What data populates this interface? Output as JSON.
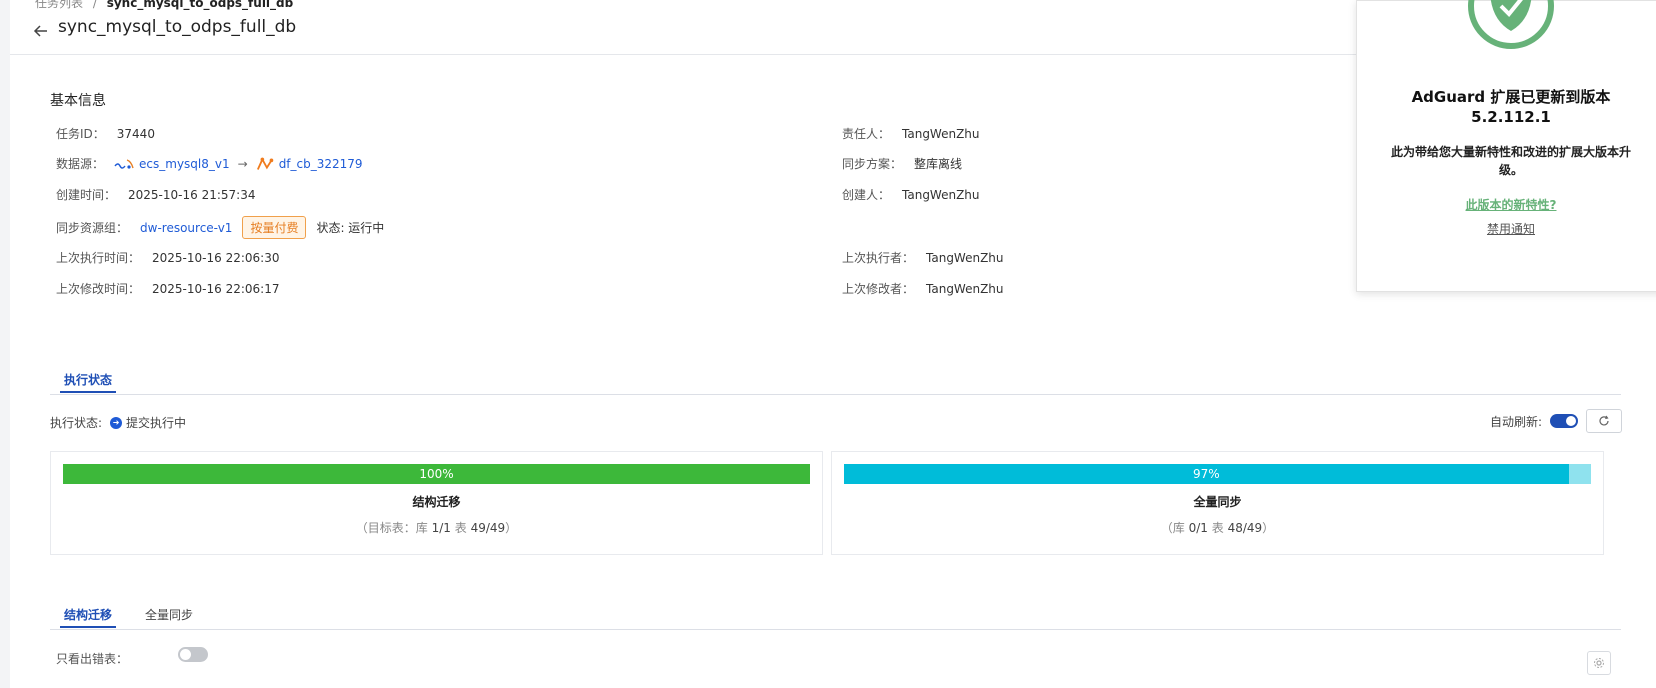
{
  "breadcrumb": {
    "parent": "任务列表",
    "separator": "/",
    "current": "sync_mysql_to_odps_full_db"
  },
  "header": {
    "title": "sync_mysql_to_odps_full_db"
  },
  "basic_info": {
    "section_title": "基本信息",
    "task_id": {
      "label": "任务ID：",
      "value": "37440"
    },
    "datasource": {
      "label": "数据源：",
      "source": "ecs_mysql8_v1",
      "arrow": "→",
      "target": "df_cb_322179"
    },
    "created_time": {
      "label": "创建时间：",
      "value": "2025-10-16 21:57:34"
    },
    "resource_group": {
      "label": "同步资源组：",
      "value": "dw-resource-v1",
      "billing_tag": "按量付费",
      "status": "状态: 运行中"
    },
    "last_exec_time": {
      "label": "上次执行时间：",
      "value": "2025-10-16 22:06:30"
    },
    "last_modified_time": {
      "label": "上次修改时间：",
      "value": "2025-10-16 22:06:17"
    },
    "owner": {
      "label": "责任人：",
      "value": "TangWenZhu"
    },
    "sync_plan": {
      "label": "同步方案：",
      "value": "整库离线"
    },
    "creator": {
      "label": "创建人：",
      "value": "TangWenZhu"
    },
    "last_executor": {
      "label": "上次执行者：",
      "value": "TangWenZhu"
    },
    "last_modifier": {
      "label": "上次修改者：",
      "value": "TangWenZhu"
    }
  },
  "exec_tabs": [
    {
      "label": "执行状态",
      "active": true
    }
  ],
  "exec_status": {
    "label": "执行状态:",
    "value": "提交执行中",
    "auto_refresh_label": "自动刷新:",
    "auto_refresh_on": true
  },
  "progress_cards": [
    {
      "percent_text": "100%",
      "progress": 1.0,
      "bar_color": "#3db83a",
      "title": "结构迁移",
      "sub_prefix": "（目标表：库 ",
      "sub_db": "1/1",
      "sub_mid": " 表 ",
      "sub_tbl": "49/49",
      "sub_suffix": "）"
    },
    {
      "percent_text": "97%",
      "progress": 0.97,
      "bar_color": "#00bcd9",
      "title": "全量同步",
      "sub_prefix": "（库 ",
      "sub_db": "0/1",
      "sub_mid": " 表 ",
      "sub_tbl": "48/49",
      "sub_suffix": "）"
    }
  ],
  "detail_tabs": [
    {
      "label": "结构迁移",
      "active": true
    },
    {
      "label": "全量同步",
      "active": false
    }
  ],
  "filter": {
    "label": "只看出错表：",
    "enabled": false
  },
  "adguard": {
    "title": "AdGuard 扩展已更新到版本 5.2.112.1",
    "description": "此为带给您大量新特性和改进的扩展大版本升级。",
    "link": "此版本的新特性?",
    "disable": "禁用通知",
    "brand_color": "#67b279"
  }
}
